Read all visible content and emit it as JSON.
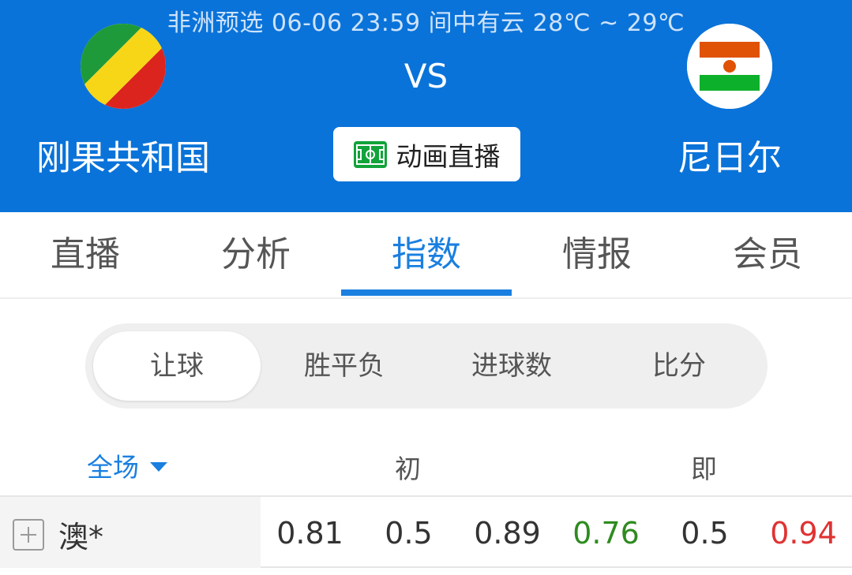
{
  "match": {
    "info": "非洲预选 06-06 23:59 间中有云 28℃ ~ 29℃",
    "vs": "VS",
    "home_team": "刚果共和国",
    "away_team": "尼日尔",
    "live_button_label": "动画直播"
  },
  "tabs": [
    {
      "label": "直播"
    },
    {
      "label": "分析"
    },
    {
      "label": "指数",
      "active": true
    },
    {
      "label": "情报"
    },
    {
      "label": "会员"
    }
  ],
  "segments": [
    {
      "label": "让球",
      "active": true
    },
    {
      "label": "胜平负"
    },
    {
      "label": "进球数"
    },
    {
      "label": "比分"
    }
  ],
  "table": {
    "scope_label": "全场",
    "initial_label": "初",
    "live_label": "即",
    "rows": [
      {
        "company": "澳*",
        "initial": [
          "0.81",
          "0.5",
          "0.89"
        ],
        "live": [
          "0.76",
          "0.5",
          "0.94"
        ]
      }
    ]
  },
  "colors": {
    "header_bg": "#0a73d9",
    "accent": "#1a7fe0",
    "odds_down": "#2e8b1f",
    "odds_up": "#e03232"
  },
  "icons": {
    "home_flag": "congo-flag-icon",
    "away_flag": "niger-flag-icon",
    "live": "football-pitch-icon",
    "dropdown": "caret-down-icon",
    "expand": "plus-box-icon"
  }
}
